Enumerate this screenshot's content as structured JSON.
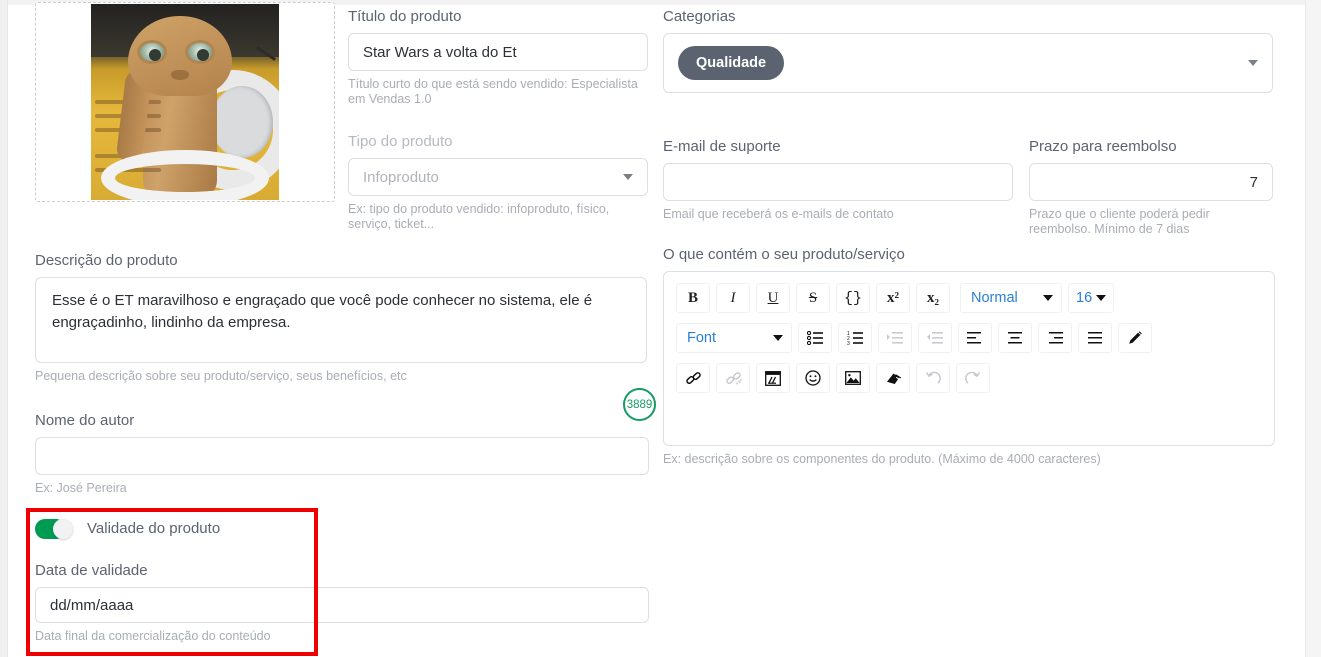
{
  "product_title": {
    "label": "Título do produto",
    "value": "Star Wars a volta do Et",
    "hint": "Título curto do que está sendo vendido: Especialista em Vendas 1.0"
  },
  "product_type": {
    "label": "Tipo do produto",
    "value": "Infoproduto",
    "hint": "Ex: tipo do produto vendido: infoproduto, físico, serviço, ticket..."
  },
  "categories": {
    "label": "Categorias",
    "chips": [
      "Qualidade"
    ]
  },
  "support_email": {
    "label": "E-mail de suporte",
    "value": "",
    "hint": "Email que receberá os e-mails de contato"
  },
  "refund_term": {
    "label": "Prazo para reembolso",
    "value": "7",
    "hint": "Prazo que o cliente poderá pedir reembolso. Mínimo de 7 dias"
  },
  "description": {
    "label": "Descrição do produto",
    "value": "Esse é o ET maravilhoso e engraçado que você pode conhecer no sistema, ele é engraçadinho, lindinho da empresa.",
    "hint": "Pequena descrição sobre seu produto/serviço, seus benefícios, etc",
    "counter": "3889"
  },
  "author": {
    "label": "Nome do autor",
    "value": "",
    "hint": "Ex: José Pereira"
  },
  "validity": {
    "toggle_label": "Validade do produto",
    "toggle_state": "on",
    "date_label": "Data de validade",
    "date_placeholder": "dd/mm/aaaa",
    "date_hint": "Data final da comercialização do conteúdo"
  },
  "content_editor": {
    "label": "O que contém o seu produto/serviço",
    "hint": "Ex: descrição sobre os componentes do produto. (Máximo de 4000 caracteres)",
    "body": "",
    "toolbar": {
      "row1": [
        {
          "name": "bold-button",
          "text": "B",
          "style": "bold"
        },
        {
          "name": "italic-button",
          "text": "I",
          "style": "italic"
        },
        {
          "name": "underline-button",
          "text": "U",
          "style": "underline"
        },
        {
          "name": "strike-button",
          "text": "S",
          "style": "strike"
        },
        {
          "name": "code-block-button",
          "text": "{}",
          "style": "plain"
        },
        {
          "name": "superscript-button",
          "text": "x²",
          "style": "plain"
        },
        {
          "name": "subscript-button",
          "text": "x₂",
          "style": "plain"
        }
      ],
      "header_select": "Normal",
      "size_select": "16",
      "font_select": "Font",
      "row2_icons": [
        "bullet-list-icon",
        "numbered-list-icon",
        "indent-increase-icon",
        "indent-decrease-icon",
        "align-left-icon",
        "align-center-icon",
        "align-right-icon",
        "align-justify-icon",
        "text-color-pencil-icon"
      ],
      "row3_icons": [
        "link-icon",
        "unlink-icon",
        "video-embed-icon",
        "emoji-icon",
        "image-icon",
        "clean-format-eraser-icon",
        "undo-icon",
        "redo-icon"
      ]
    }
  },
  "thumbnail": {
    "alt": "product-image-et-figurine"
  },
  "colors": {
    "accent_green": "#009b52",
    "counter_green": "#169b62",
    "chip_slate": "#5b6270",
    "editor_blue": "#2a7fd4",
    "highlight_red": "#ee0000",
    "border_grey": "#dcdfe3",
    "label_grey": "#5c6370",
    "hint_grey": "#a9adb4"
  }
}
